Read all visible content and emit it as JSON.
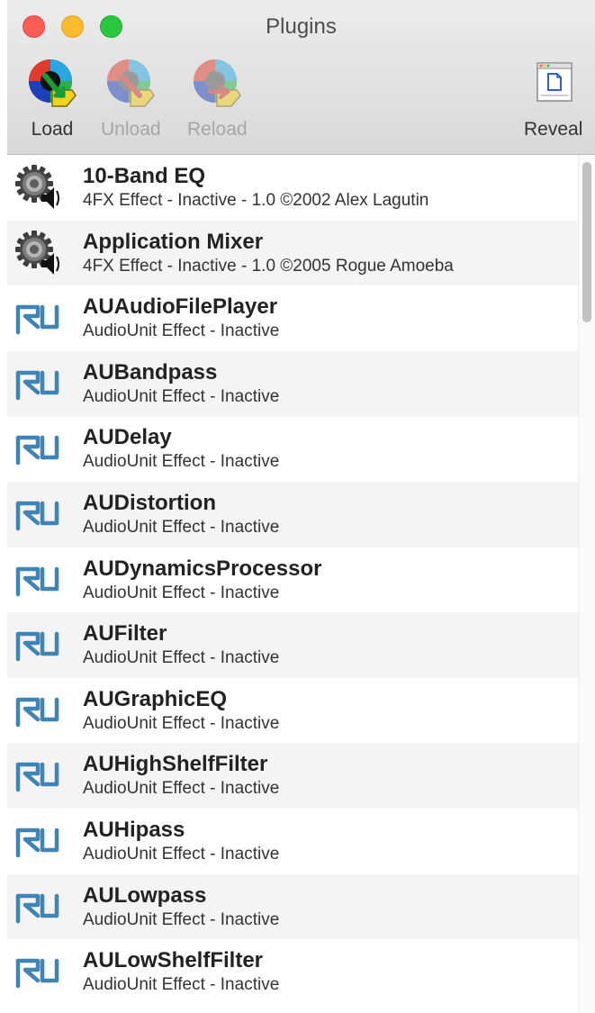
{
  "window": {
    "title": "Plugins"
  },
  "toolbar": {
    "load_label": "Load",
    "unload_label": "Unload",
    "reload_label": "Reload",
    "reveal_label": "Reveal"
  },
  "plugins": [
    {
      "name": "10-Band EQ",
      "desc": "4FX Effect - Inactive - 1.0 ©2002 Alex Lagutin",
      "icon": "gear-speaker-icon"
    },
    {
      "name": "Application Mixer",
      "desc": "4FX Effect - Inactive - 1.0 ©2005 Rogue Amoeba",
      "icon": "gear-speaker-icon"
    },
    {
      "name": "AUAudioFilePlayer",
      "desc": "AudioUnit Effect - Inactive",
      "icon": "audio-unit-icon"
    },
    {
      "name": "AUBandpass",
      "desc": "AudioUnit Effect - Inactive",
      "icon": "audio-unit-icon"
    },
    {
      "name": "AUDelay",
      "desc": "AudioUnit Effect - Inactive",
      "icon": "audio-unit-icon"
    },
    {
      "name": "AUDistortion",
      "desc": "AudioUnit Effect - Inactive",
      "icon": "audio-unit-icon"
    },
    {
      "name": "AUDynamicsProcessor",
      "desc": "AudioUnit Effect - Inactive",
      "icon": "audio-unit-icon"
    },
    {
      "name": "AUFilter",
      "desc": "AudioUnit Effect - Inactive",
      "icon": "audio-unit-icon"
    },
    {
      "name": "AUGraphicEQ",
      "desc": "AudioUnit Effect - Inactive",
      "icon": "audio-unit-icon"
    },
    {
      "name": "AUHighShelfFilter",
      "desc": "AudioUnit Effect - Inactive",
      "icon": "audio-unit-icon"
    },
    {
      "name": "AUHipass",
      "desc": "AudioUnit Effect - Inactive",
      "icon": "audio-unit-icon"
    },
    {
      "name": "AULowpass",
      "desc": "AudioUnit Effect - Inactive",
      "icon": "audio-unit-icon"
    },
    {
      "name": "AULowShelfFilter",
      "desc": "AudioUnit Effect - Inactive",
      "icon": "audio-unit-icon"
    }
  ],
  "colors": {
    "au_icon": "#3f84b4",
    "alt_row": "#f4f4f4"
  }
}
